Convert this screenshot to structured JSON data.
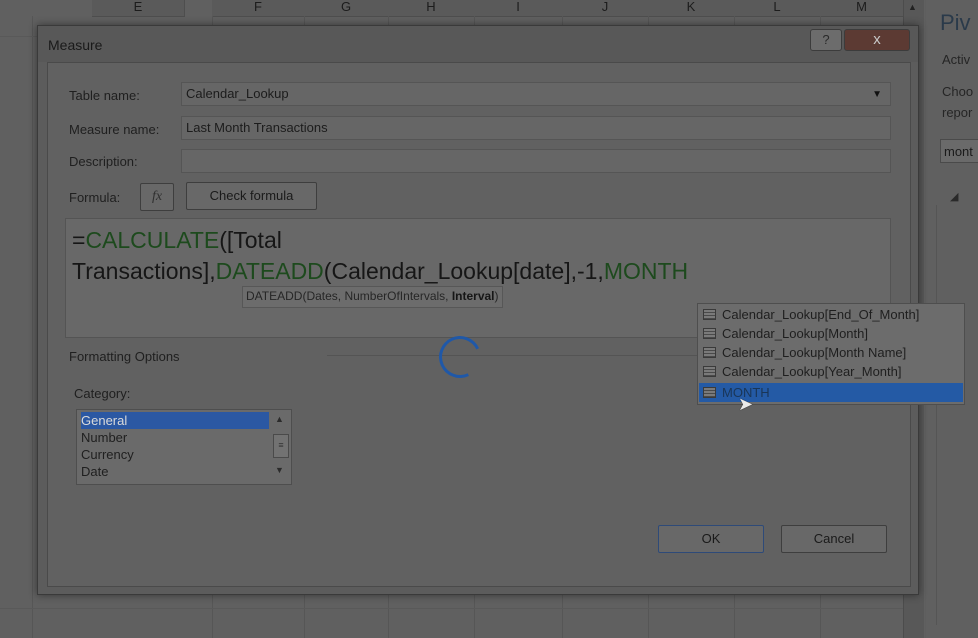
{
  "sheet": {
    "columns": [
      "E",
      "F",
      "G",
      "H",
      "I",
      "J",
      "K",
      "L",
      "M"
    ]
  },
  "pivot_panel": {
    "title": "Piv",
    "active": "Activ",
    "choose_line1": "Choo",
    "choose_line2": "repor",
    "search_value": "mont",
    "tree_toggle": "◢"
  },
  "dialog": {
    "title": "Measure",
    "help_label": "?",
    "close_label": "x",
    "table_name_label": "Table name:",
    "table_name_value": "Calendar_Lookup",
    "measure_name_label": "Measure name:",
    "measure_name_value": "Last Month Transactions",
    "description_label": "Description:",
    "description_value": "",
    "formula_label": "Formula:",
    "fx_label": "fx",
    "check_formula_label": "Check formula",
    "formula": {
      "p1": "=",
      "p2": "CALCULATE",
      "p3": "([Total",
      "p4": "Transactions],",
      "p5": "DATEADD",
      "p6": "(Calendar_Lookup[date],-1,",
      "p7": "MONTH"
    },
    "tooltip": {
      "prefix": "DATEADD(Dates, NumberOfIntervals, ",
      "bold": "Interval",
      "suffix": ")"
    },
    "formatting_options_label": "Formatting Options",
    "category_label": "Category:",
    "categories": [
      "General",
      "Number",
      "Currency",
      "Date"
    ],
    "selected_category": "General",
    "ok_label": "OK",
    "cancel_label": "Cancel"
  },
  "autocomplete": {
    "items": [
      "Calendar_Lookup[End_Of_Month]",
      "Calendar_Lookup[Month]",
      "Calendar_Lookup[Month Name]",
      "Calendar_Lookup[Year_Month]",
      "MONTH"
    ],
    "selected": "MONTH"
  },
  "colors": {
    "formula_keyword": "#1d4a1d",
    "selection": "#2b58a3",
    "spinner": "#1f58a8"
  }
}
